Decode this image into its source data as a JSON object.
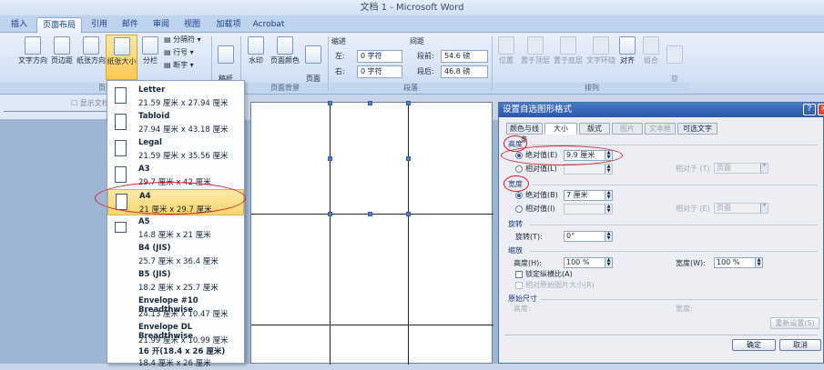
{
  "window": {
    "title": "文档 1 - Microsoft Word"
  },
  "tabs": [
    "插入",
    "页面布局",
    "引用",
    "邮件",
    "审阅",
    "视图",
    "加载项",
    "Acrobat"
  ],
  "active_tab_index": 1,
  "ribbon": {
    "page_setup": {
      "buttons": [
        "文字方向",
        "页边距",
        "纸张方向",
        "纸张大小",
        "分栏"
      ],
      "small_items": [
        "分隔符",
        "行号",
        "断字"
      ],
      "label": "页面"
    },
    "manuscript": {
      "label": "稿纸\n设置"
    },
    "background": {
      "buttons": [
        "水印",
        "页面颜色",
        "页面\n边框"
      ],
      "label": "页面背景"
    },
    "paragraph": {
      "indent_title": "缩进",
      "spacing_title": "间距",
      "indent_left_label": "左:",
      "indent_left_value": "0 字符",
      "indent_right_label": "右:",
      "indent_right_value": "0 字符",
      "spacing_before_label": "段前:",
      "spacing_before_value": "54.6 磅",
      "spacing_after_label": "段后:",
      "spacing_after_value": "46.8 磅",
      "label": "段落"
    },
    "arrange": {
      "buttons": [
        "位置",
        "置于顶层",
        "置于底层",
        "文字环绕",
        "对齐",
        "组合",
        "旋\n转"
      ],
      "label": "排列"
    }
  },
  "toolbar2": {
    "text": "显示文档"
  },
  "paper_menu": {
    "items": [
      {
        "name": "Letter",
        "size": "21.59 厘米 x 27.94 厘米"
      },
      {
        "name": "Tabloid",
        "size": "27.94 厘米 x 43.18 厘米"
      },
      {
        "name": "Legal",
        "size": "21.59 厘米 x 35.56 厘米"
      },
      {
        "name": "A3",
        "size": "29.7 厘米 x 42 厘米"
      },
      {
        "name": "A4",
        "size": "21 厘米 x 29.7 厘米"
      },
      {
        "name": "A5",
        "size": "14.8 厘米 x 21 厘米"
      },
      {
        "name": "B4 (JIS)",
        "size": "25.7 厘米 x 36.4 厘米"
      },
      {
        "name": "B5 (JIS)",
        "size": "18.2 厘米 x 25.7 厘米"
      },
      {
        "name": "Envelope #10 Breadthwise",
        "size": "24.13 厘米 x 10.47 厘米"
      },
      {
        "name": "Envelope DL Breadthwise",
        "size": "21.99 厘米 x 10.99 厘米"
      },
      {
        "name": "16 开(18.4 x 26 厘米)",
        "size": "18.4 厘米 x 26 厘米"
      }
    ],
    "selected_index": 4
  },
  "dialog": {
    "title": "设置自选图形格式",
    "tabs": [
      "颜色与线条",
      "大小",
      "版式",
      "图片",
      "文本框",
      "可选文字"
    ],
    "active_tab_index": 1,
    "height_section": "高度",
    "height_abs_label": "绝对值(E)",
    "height_abs_value": "9.9 厘米",
    "height_rel_label": "相对值(L)",
    "relative_to_label": "相对于 (T)",
    "relative_to_value": "页面",
    "width_section": "宽度",
    "width_abs_label": "绝对值(B)",
    "width_abs_value": "7 厘米",
    "width_rel_label": "相对值(I)",
    "width_relative_to_label": "相对于 (E)",
    "width_relative_to_value": "页面",
    "rotate_section": "旋转",
    "rotate_label": "旋转(T):",
    "rotate_value": "0°",
    "scale_section": "缩放",
    "scale_h_label": "高度(H):",
    "scale_h_value": "100 %",
    "scale_w_label": "宽度(W):",
    "scale_w_value": "100 %",
    "lock_ratio_label": "锁定纵横比(A)",
    "relative_orig_label": "相对原始图片大小(R)",
    "orig_section": "原始尺寸",
    "orig_h_label": "高度:",
    "orig_w_label": "宽度:",
    "reset_label": "重新设置(S)",
    "ok_label": "确定",
    "cancel_label": "取消"
  }
}
